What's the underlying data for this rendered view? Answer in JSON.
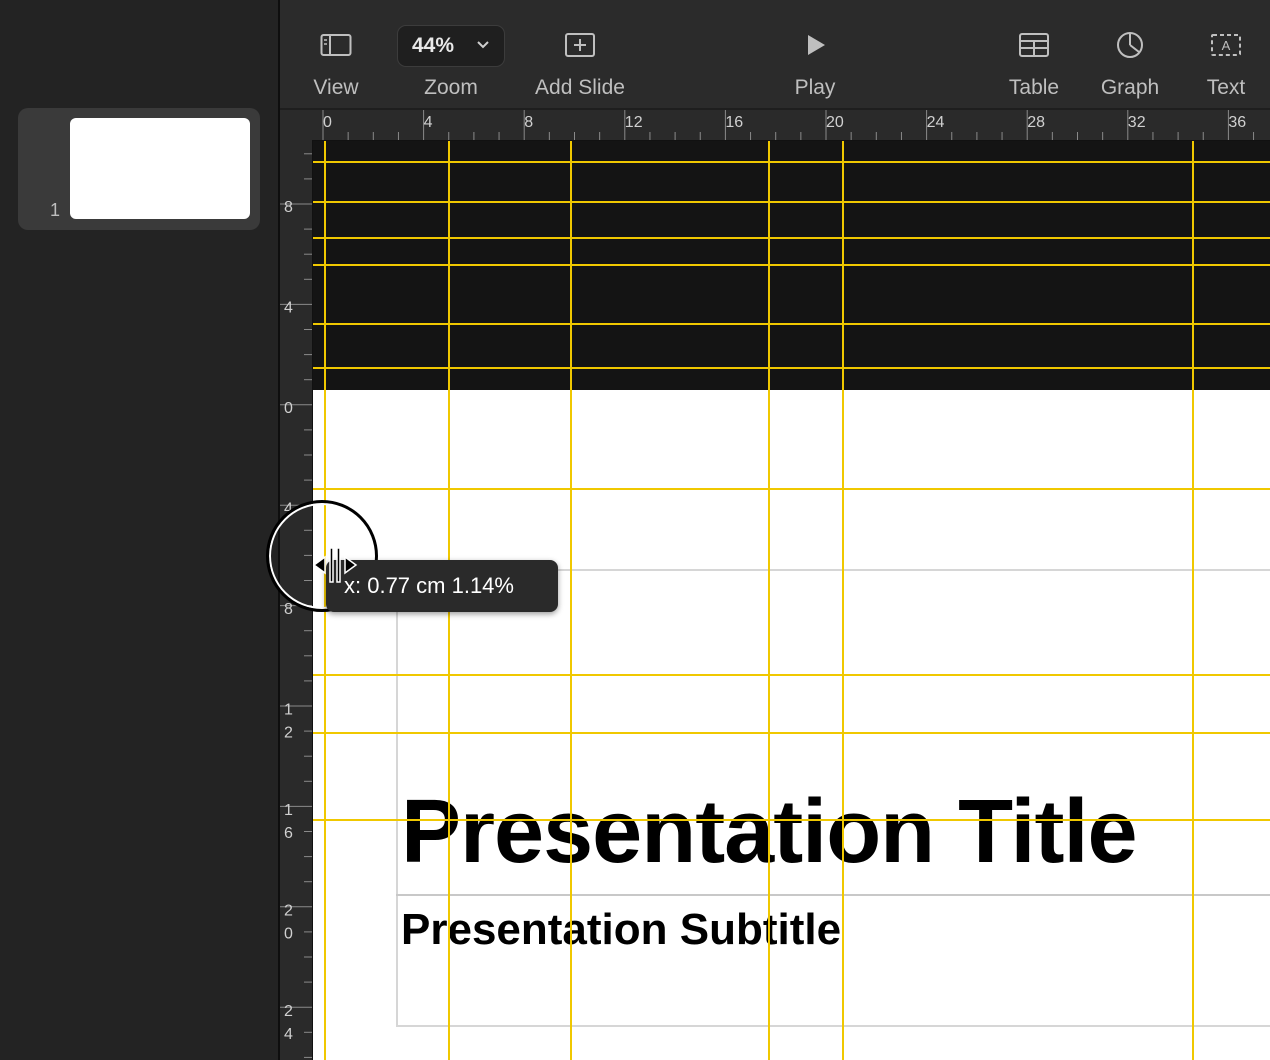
{
  "sidebar": {
    "slides": [
      {
        "number": "1"
      }
    ]
  },
  "toolbar": {
    "view_label": "View",
    "zoom_value": "44%",
    "zoom_label": "Zoom",
    "add_slide_label": "Add Slide",
    "play_label": "Play",
    "table_label": "Table",
    "graph_label": "Graph",
    "text_label": "Text"
  },
  "rulers": {
    "horizontal_labels": [
      "0",
      "4",
      "8",
      "12",
      "16",
      "20",
      "24",
      "28",
      "32",
      "36"
    ],
    "vertical_labels": [
      "8",
      "4",
      "0",
      "4",
      "8",
      "1\n2",
      "1\n6",
      "2\n0",
      "2\n4"
    ]
  },
  "slide": {
    "title": "Presentation Title",
    "subtitle": "Presentation Subtitle"
  },
  "tooltip": {
    "text": "x: 0.77 cm  1.14%"
  },
  "colors": {
    "guide": "#f0c800",
    "toolbar_bg": "#2b2b2b",
    "sidebar_bg": "#232323"
  }
}
